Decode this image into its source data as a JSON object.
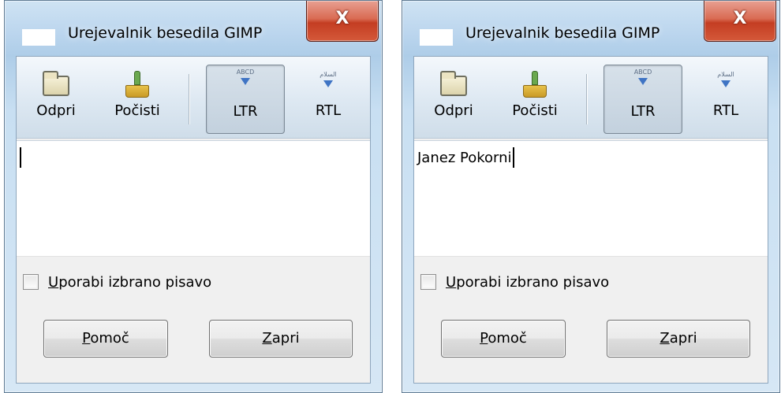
{
  "windows": [
    {
      "title": "Urejevalnik besedila GIMP",
      "close_label": "X",
      "toolbar": {
        "open_label": "Odpri",
        "clear_label": "Počisti",
        "ltr_label": "LTR",
        "ltr_icon_text": "ABCD",
        "rtl_label": "RTL",
        "rtl_icon_text": "السلام"
      },
      "editor_text": "",
      "checkbox": {
        "access_key": "U",
        "rest": "porabi izbrano pisavo",
        "checked": false
      },
      "help_button": {
        "access_key": "P",
        "rest": "omoč"
      },
      "close_button": {
        "access_key": "Z",
        "rest": "apri"
      }
    },
    {
      "title": "Urejevalnik besedila GIMP",
      "close_label": "X",
      "toolbar": {
        "open_label": "Odpri",
        "clear_label": "Počisti",
        "ltr_label": "LTR",
        "ltr_icon_text": "ABCD",
        "rtl_label": "RTL",
        "rtl_icon_text": "السلام"
      },
      "editor_text": "Janez Pokorni",
      "checkbox": {
        "access_key": "U",
        "rest": "porabi izbrano pisavo",
        "checked": false
      },
      "help_button": {
        "access_key": "P",
        "rest": "omoč"
      },
      "close_button": {
        "access_key": "Z",
        "rest": "apri"
      }
    }
  ],
  "colors": {
    "close_button": "#c43d22",
    "frame_glass": "#aecde8",
    "icon_arrow": "#3f74c4"
  }
}
